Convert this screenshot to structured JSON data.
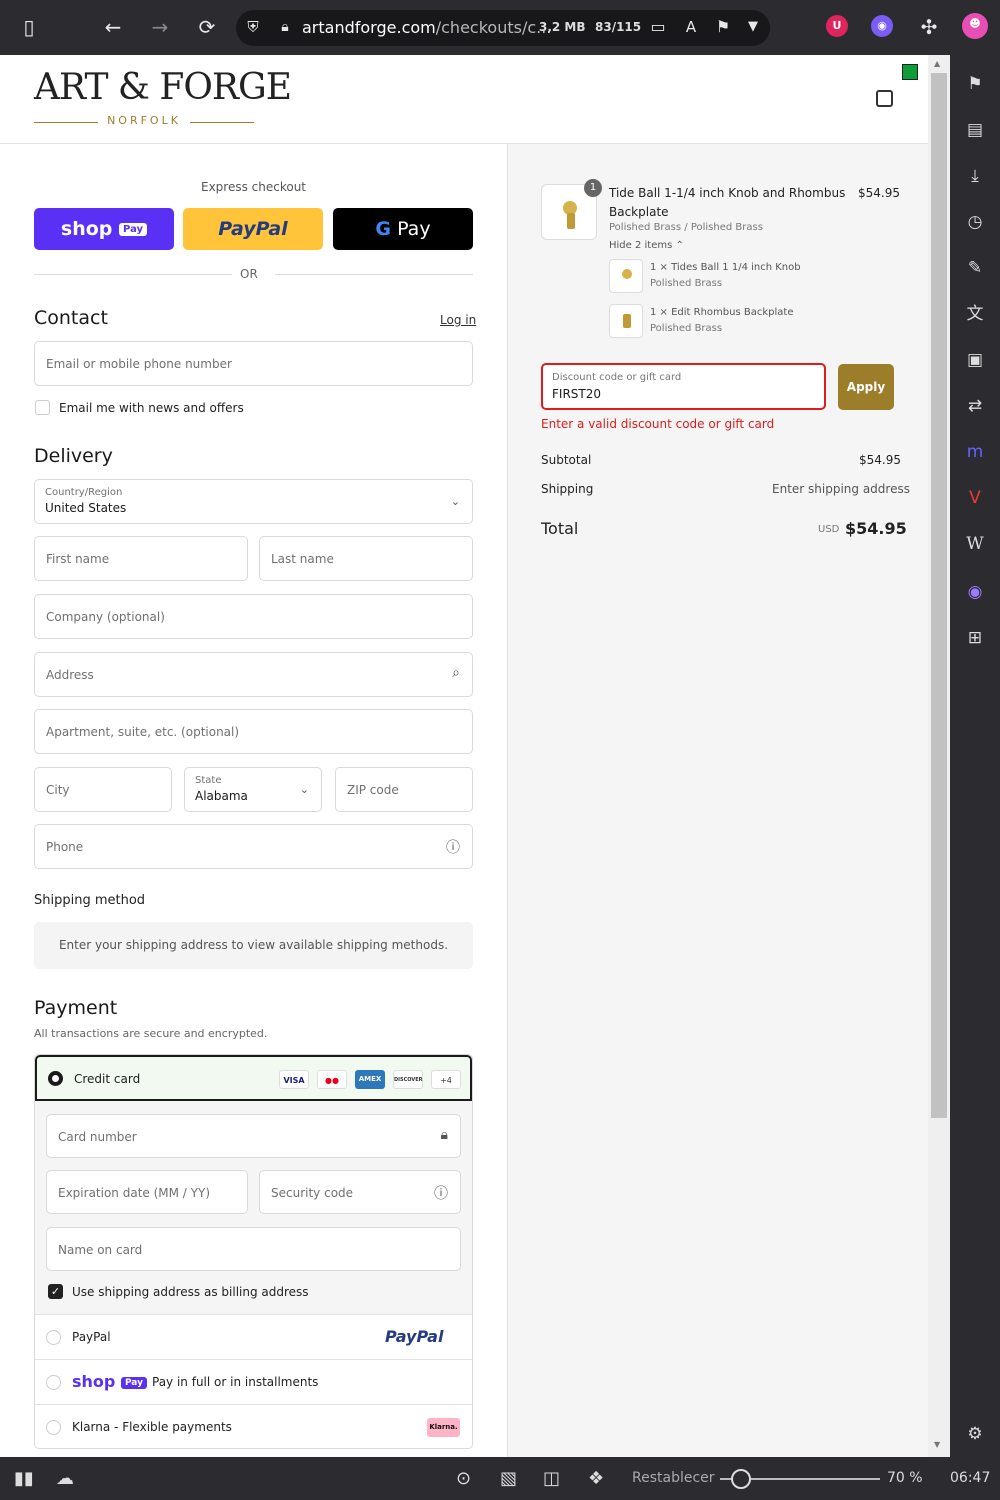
{
  "browser": {
    "url_host": "artandforge.com",
    "url_path": "/checkouts/c...",
    "size_stat": "3,2 MB",
    "tab_count": "83/115",
    "status_bar": {
      "reset_label": "Restablecer",
      "zoom": "70 %",
      "time": "06:47"
    }
  },
  "store": {
    "logo": "ART & FORGE",
    "logo_sub": "NORFOLK"
  },
  "express": {
    "label": "Express checkout",
    "shop_pay": "shop",
    "shop_pay_badge": "Pay",
    "paypal": "PayPal",
    "gpay": "Pay",
    "or_text": "OR"
  },
  "contact": {
    "title": "Contact",
    "login": "Log in",
    "email_placeholder": "Email or mobile phone number",
    "newsletter": "Email me with news and offers"
  },
  "delivery": {
    "title": "Delivery",
    "country_label": "Country/Region",
    "country_value": "United States",
    "first_name": "First name",
    "last_name": "Last name",
    "company": "Company (optional)",
    "address": "Address",
    "apartment": "Apartment, suite, etc. (optional)",
    "city": "City",
    "state_label": "State",
    "state_value": "Alabama",
    "zip": "ZIP code",
    "phone": "Phone"
  },
  "shipping_method": {
    "title": "Shipping method",
    "message": "Enter your shipping address to view available shipping methods."
  },
  "payment": {
    "title": "Payment",
    "subtitle": "All transactions are secure and encrypted.",
    "credit_card": "Credit card",
    "card_logos": [
      "VISA",
      "MC",
      "AMEX",
      "DISCOVER"
    ],
    "more_cards": "+4",
    "card_number": "Card number",
    "expiration": "Expiration date (MM / YY)",
    "security_code": "Security code",
    "name_on_card": "Name on card",
    "billing_same": "Use shipping address as billing address",
    "paypal": "PayPal",
    "paypal_logo": "PayPal",
    "shop_pay_text": "Pay in full or in installments",
    "shop_logo": "shop",
    "shop_badge": "Pay",
    "klarna": "Klarna - Flexible payments",
    "klarna_logo": "Klarna."
  },
  "summary": {
    "item_qty": "1",
    "item_title_1": "Tide Ball 1-1/4 inch Knob and Rhombus",
    "item_title_2": "Backplate",
    "item_variant": "Polished Brass / Polished Brass",
    "item_price": "$54.95",
    "hide_items": "Hide 2 items",
    "sub_items": [
      {
        "name": "1 × Tides Ball 1 1/4 inch Knob",
        "variant": "Polished Brass"
      },
      {
        "name": "1 × Edit Rhombus Backplate",
        "variant": "Polished Brass"
      }
    ],
    "discount_label": "Discount code or gift card",
    "discount_value": "FIRST20",
    "apply": "Apply",
    "error": "Enter a valid discount code or gift card",
    "subtotal_label": "Subtotal",
    "subtotal_value": "$54.95",
    "shipping_label": "Shipping",
    "shipping_value": "Enter shipping address",
    "total_label": "Total",
    "currency": "USD",
    "total_value": "$54.95"
  }
}
